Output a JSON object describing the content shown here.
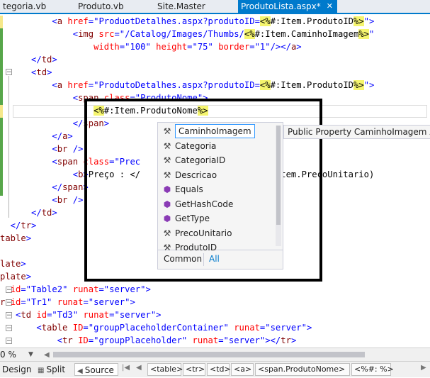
{
  "tabs": [
    {
      "label": "tegoria.vb",
      "active": false
    },
    {
      "label": "Produto.vb",
      "active": false
    },
    {
      "label": "Site.Master",
      "active": false
    },
    {
      "label": "ProdutoLista.aspx*",
      "active": true
    }
  ],
  "code_lines": [
    [
      {
        "c": "v",
        "s": "          <"
      },
      {
        "c": "t",
        "s": "a"
      },
      {
        "c": "",
        "s": " "
      },
      {
        "c": "a",
        "s": "href"
      },
      {
        "c": "v",
        "s": "=\"ProduotDetalhes.aspx?produtoID="
      },
      {
        "c": "hl",
        "s": "<%"
      },
      {
        "c": "",
        "s": "#:Item.ProdutoID"
      },
      {
        "c": "hl",
        "s": "%>"
      },
      {
        "c": "v",
        "s": "\">"
      }
    ],
    [
      {
        "c": "v",
        "s": "              <"
      },
      {
        "c": "t",
        "s": "img"
      },
      {
        "c": "",
        "s": " "
      },
      {
        "c": "a",
        "s": "src"
      },
      {
        "c": "v",
        "s": "=\"/Catalog/Images/Thumbs/"
      },
      {
        "c": "hl",
        "s": "<%"
      },
      {
        "c": "",
        "s": "#:Item.CaminhoImagem"
      },
      {
        "c": "hl",
        "s": "%>"
      },
      {
        "c": "v",
        "s": "\""
      }
    ],
    [
      {
        "c": "",
        "s": "                  "
      },
      {
        "c": "a",
        "s": "width"
      },
      {
        "c": "v",
        "s": "=\"100\" "
      },
      {
        "c": "a",
        "s": "height"
      },
      {
        "c": "v",
        "s": "=\"75\" "
      },
      {
        "c": "a",
        "s": "border"
      },
      {
        "c": "v",
        "s": "=\"1\"/></"
      },
      {
        "c": "t",
        "s": "a"
      },
      {
        "c": "v",
        "s": ">"
      }
    ],
    [
      {
        "c": "v",
        "s": "      </"
      },
      {
        "c": "t",
        "s": "td"
      },
      {
        "c": "v",
        "s": ">"
      }
    ],
    [
      {
        "c": "v",
        "s": "      <"
      },
      {
        "c": "t",
        "s": "td"
      },
      {
        "c": "v",
        "s": ">"
      }
    ],
    [
      {
        "c": "v",
        "s": "          <"
      },
      {
        "c": "t",
        "s": "a"
      },
      {
        "c": "",
        "s": " "
      },
      {
        "c": "a",
        "s": "href"
      },
      {
        "c": "v",
        "s": "=\"ProdutoDetalhes.aspx?produtoID="
      },
      {
        "c": "hl",
        "s": "<%"
      },
      {
        "c": "",
        "s": "#:Item.ProdutoID"
      },
      {
        "c": "hl",
        "s": "%>"
      },
      {
        "c": "v",
        "s": "\">"
      }
    ],
    [
      {
        "c": "v",
        "s": "              <"
      },
      {
        "c": "t",
        "s": "span"
      },
      {
        "c": "",
        "s": " "
      },
      {
        "c": "a",
        "s": "class"
      },
      {
        "c": "v",
        "s": "=\"ProdutoNome\">"
      }
    ],
    [
      {
        "c": "",
        "s": "                  "
      },
      {
        "c": "hl",
        "s": "<%"
      },
      {
        "c": "",
        "s": "#:Item.ProdutoNome"
      },
      {
        "c": "hl",
        "s": "%>"
      }
    ],
    [
      {
        "c": "v",
        "s": "              </"
      },
      {
        "c": "t",
        "s": "span"
      },
      {
        "c": "v",
        "s": ">"
      }
    ],
    [
      {
        "c": "v",
        "s": "          </"
      },
      {
        "c": "t",
        "s": "a"
      },
      {
        "c": "v",
        "s": ">"
      }
    ],
    [
      {
        "c": "v",
        "s": "          <"
      },
      {
        "c": "t",
        "s": "br"
      },
      {
        "c": "v",
        "s": " />"
      }
    ],
    [
      {
        "c": "v",
        "s": "          <"
      },
      {
        "c": "t",
        "s": "span"
      },
      {
        "c": "",
        "s": " "
      },
      {
        "c": "a",
        "s": "class"
      },
      {
        "c": "v",
        "s": "=\"Prec"
      }
    ],
    [
      {
        "c": "v",
        "s": "              <"
      },
      {
        "c": "t",
        "s": "b"
      },
      {
        "c": "v",
        "s": ">"
      },
      {
        "c": "",
        "s": "Preço : </"
      },
      {
        "c": "",
        "s": "                    "
      },
      {
        "c": "",
        "s": ":c}\", Item.PrecoUnitario)"
      }
    ],
    [
      {
        "c": "v",
        "s": "          </"
      },
      {
        "c": "t",
        "s": "span"
      },
      {
        "c": "v",
        "s": ">"
      }
    ],
    [
      {
        "c": "v",
        "s": "          <"
      },
      {
        "c": "t",
        "s": "br"
      },
      {
        "c": "v",
        "s": " />"
      }
    ],
    [
      {
        "c": "v",
        "s": "      </"
      },
      {
        "c": "t",
        "s": "td"
      },
      {
        "c": "v",
        "s": ">"
      }
    ],
    [
      {
        "c": "v",
        "s": "  </"
      },
      {
        "c": "t",
        "s": "tr"
      },
      {
        "c": "v",
        "s": ">"
      }
    ],
    [
      {
        "c": "t",
        "s": "table"
      },
      {
        "c": "v",
        "s": ">"
      }
    ],
    [
      {
        "c": "",
        "s": ""
      }
    ],
    [
      {
        "c": "t",
        "s": "late"
      },
      {
        "c": "v",
        "s": ">"
      }
    ],
    [
      {
        "c": "t",
        "s": "plate"
      },
      {
        "c": "v",
        "s": ">"
      }
    ],
    [
      {
        "c": "",
        "s": "  "
      },
      {
        "c": "a",
        "s": "id"
      },
      {
        "c": "v",
        "s": "=\"Table2\" "
      },
      {
        "c": "a",
        "s": "runat"
      },
      {
        "c": "v",
        "s": "=\"server\">"
      }
    ],
    [
      {
        "c": "t",
        "s": "r"
      },
      {
        "c": "",
        "s": " "
      },
      {
        "c": "a",
        "s": "id"
      },
      {
        "c": "v",
        "s": "=\"Tr1\" "
      },
      {
        "c": "a",
        "s": "runat"
      },
      {
        "c": "v",
        "s": "=\"server\">"
      }
    ],
    [
      {
        "c": "v",
        "s": "   <"
      },
      {
        "c": "t",
        "s": "td"
      },
      {
        "c": "",
        "s": " "
      },
      {
        "c": "a",
        "s": "id"
      },
      {
        "c": "v",
        "s": "=\"Td3\" "
      },
      {
        "c": "a",
        "s": "runat"
      },
      {
        "c": "v",
        "s": "=\"server\">"
      }
    ],
    [
      {
        "c": "v",
        "s": "       <"
      },
      {
        "c": "t",
        "s": "table"
      },
      {
        "c": "",
        "s": " "
      },
      {
        "c": "a",
        "s": "ID"
      },
      {
        "c": "v",
        "s": "=\"groupPlaceholderContainer\" "
      },
      {
        "c": "a",
        "s": "runat"
      },
      {
        "c": "v",
        "s": "=\"server\">"
      }
    ],
    [
      {
        "c": "v",
        "s": "           <"
      },
      {
        "c": "t",
        "s": "tr"
      },
      {
        "c": "",
        "s": " "
      },
      {
        "c": "a",
        "s": "ID"
      },
      {
        "c": "v",
        "s": "=\"groupPlaceholder\" "
      },
      {
        "c": "a",
        "s": "runat"
      },
      {
        "c": "v",
        "s": "=\"server\"></"
      },
      {
        "c": "t",
        "s": "tr"
      },
      {
        "c": "v",
        "s": ">"
      }
    ]
  ],
  "completion": {
    "items": [
      {
        "label": "CaminhoImagem",
        "icon": "wrench-icon",
        "selected": true
      },
      {
        "label": "Categoria",
        "icon": "wrench-icon",
        "selected": false
      },
      {
        "label": "CategoriaID",
        "icon": "wrench-icon",
        "selected": false
      },
      {
        "label": "Descricao",
        "icon": "wrench-icon",
        "selected": false
      },
      {
        "label": "Equals",
        "icon": "cube-icon",
        "selected": false
      },
      {
        "label": "GetHashCode",
        "icon": "cube-icon",
        "selected": false
      },
      {
        "label": "GetType",
        "icon": "cube-icon",
        "selected": false
      },
      {
        "label": "PrecoUnitario",
        "icon": "wrench-icon",
        "selected": false
      },
      {
        "label": "ProdutoID",
        "icon": "wrench-icon",
        "selected": false
      }
    ],
    "tab_common": "Common",
    "tab_all": "All"
  },
  "tooltip": "Public Property CaminhoImagem As",
  "zoom": "0 %",
  "views": {
    "design": "Design",
    "split": "Split",
    "source": "Source"
  },
  "breadcrumbs": [
    "<table>",
    "<tr>",
    "<td>",
    "<a>",
    "<span.ProdutoNome>",
    "<%#: %>"
  ]
}
